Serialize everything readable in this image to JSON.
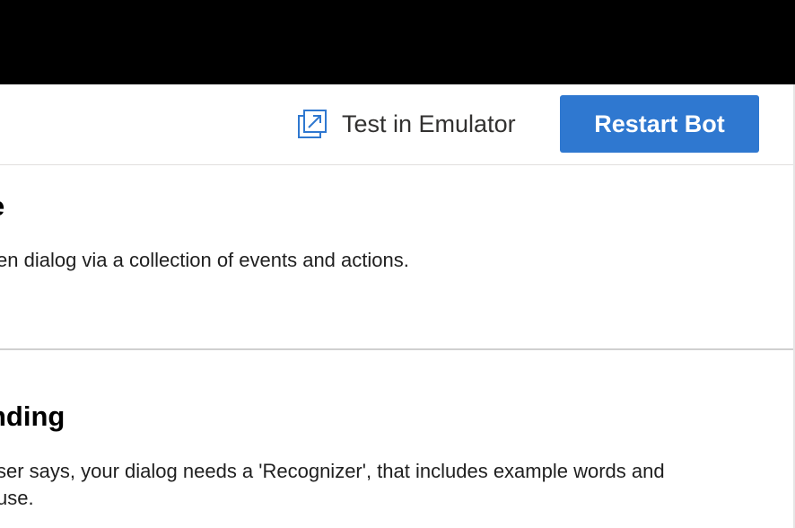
{
  "toolbar": {
    "emulator_label": "Test in Emulator",
    "emulator_icon": "open-external-icon",
    "restart_label": "Restart Bot",
    "accent_color": "#2f78d0"
  },
  "sections": [
    {
      "heading": "e",
      "description_lines": [
        "en dialog via a collection of events and actions."
      ]
    },
    {
      "heading": "nding",
      "description_lines": [
        "ser says, your dialog needs a 'Recognizer', that includes example words and",
        "use."
      ]
    }
  ]
}
